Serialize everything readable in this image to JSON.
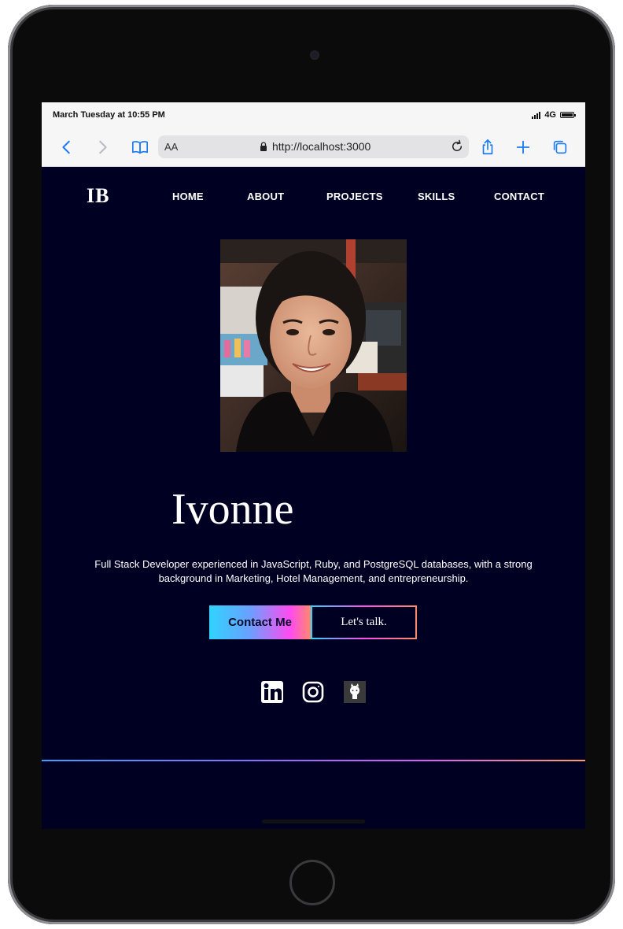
{
  "statusbar": {
    "time": "March Tuesday at 10:55 PM",
    "network": "4G"
  },
  "browser": {
    "aa_label": "AA",
    "url": "http://localhost:3000"
  },
  "site": {
    "logo": "IB",
    "nav": [
      {
        "label": "HOME"
      },
      {
        "label": "ABOUT"
      },
      {
        "label": "PROJECTS"
      },
      {
        "label": "SKILLS"
      },
      {
        "label": "CONTACT"
      }
    ],
    "hero": {
      "name": "Ivonne",
      "bio": "Full Stack Developer experienced in JavaScript, Ruby, and PostgreSQL databases, with a strong background in Marketing, Hotel Management, and entrepreneurship.",
      "contact_label": "Contact Me",
      "talk_label": "Let's talk."
    },
    "socials": [
      {
        "icon": "linkedin-icon"
      },
      {
        "icon": "instagram-icon"
      },
      {
        "icon": "github-icon"
      }
    ]
  },
  "colors": {
    "background": "#000022",
    "accent_start": "#2fd3ff",
    "accent_mid": "#ff4bf0",
    "accent_end": "#ff8a6a",
    "safari_blue": "#1a7cf2"
  }
}
